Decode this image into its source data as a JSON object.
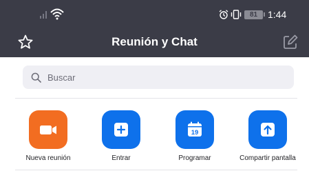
{
  "status_bar": {
    "battery": "81",
    "time": "1:44",
    "icons": [
      "signal-icon",
      "wifi-icon",
      "alarm-icon",
      "vibrate-icon",
      "battery-icon"
    ]
  },
  "header": {
    "title": "Reunión y Chat",
    "left_icon": "star-icon",
    "right_icon": "compose-icon",
    "background": "#3b3c47"
  },
  "search": {
    "placeholder": "Buscar",
    "value": ""
  },
  "actions": [
    {
      "label": "Nueva reunión",
      "icon": "video-camera-icon",
      "color": "#f26d21"
    },
    {
      "label": "Entrar",
      "icon": "plus-icon",
      "color": "#0e71eb"
    },
    {
      "label": "Programar",
      "icon": "calendar-icon",
      "color": "#0e71eb",
      "calendar_day": "19"
    },
    {
      "label": "Compartir pantalla",
      "icon": "share-screen-icon",
      "color": "#0e71eb"
    }
  ]
}
